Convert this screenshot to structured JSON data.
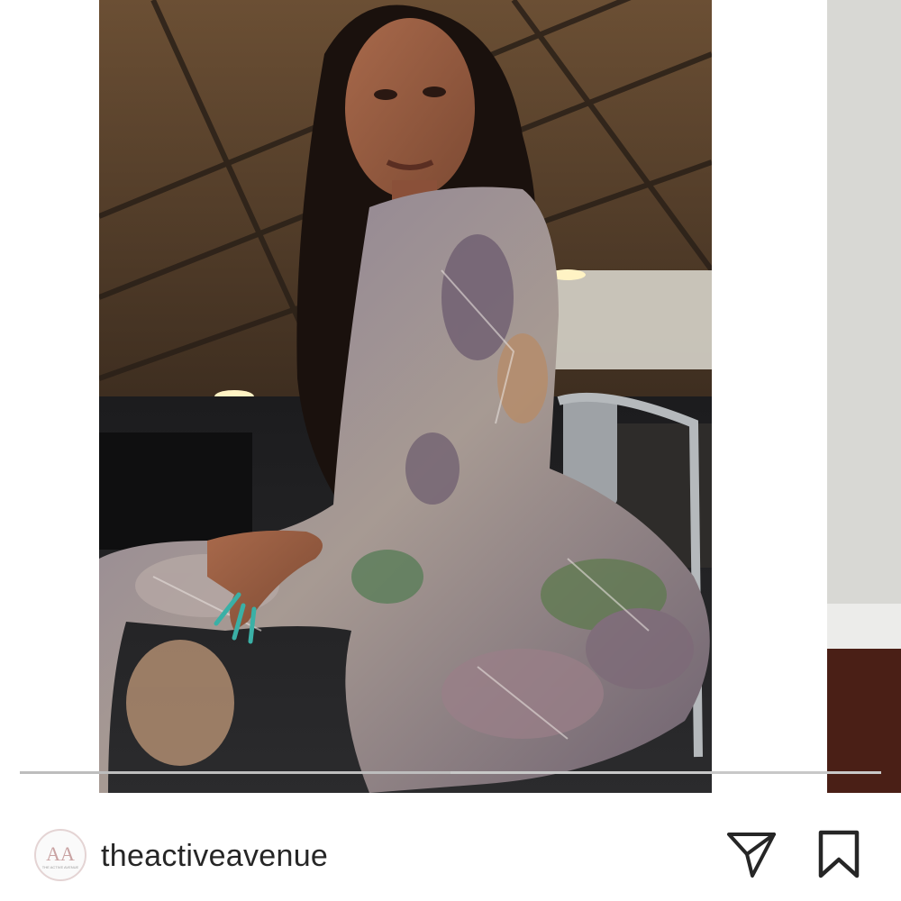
{
  "post": {
    "username": "theactiveavenue",
    "avatar_monogram": "AA",
    "avatar_caption": "THE ACTIVE AVENUE"
  },
  "carousel": {
    "current_progress": 0.5
  },
  "actions": {
    "share_icon": "paper-plane-icon",
    "save_icon": "bookmark-icon"
  },
  "colors": {
    "text": "#262626",
    "avatar_ring": "#e4d4d4",
    "progress_track": "#c8c8c8"
  }
}
